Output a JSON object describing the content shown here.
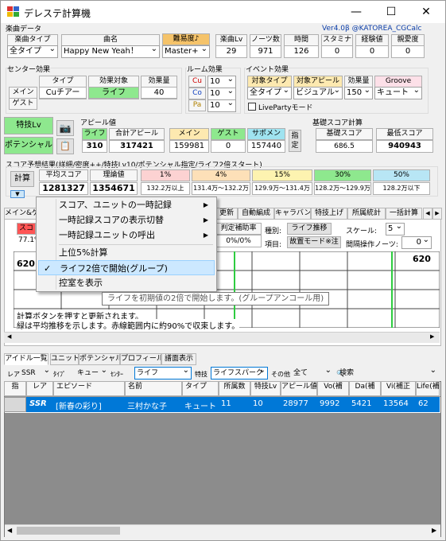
{
  "window": {
    "title": "デレステ計算機",
    "minimize": "—",
    "maximize": "☐",
    "close": "✕"
  },
  "song": {
    "section": "楽曲データ",
    "version": "Ver4.0β @KATOREA_CGCalc",
    "headers": {
      "type": "楽曲タイプ",
      "name": "曲名",
      "difficulty": "難易度♪",
      "level": "楽曲Lv",
      "notes": "ノーツ数",
      "time": "時間",
      "stamina": "スタミナ",
      "exp": "経験値",
      "affection": "親愛度"
    },
    "values": {
      "type": "全タイプ",
      "name": "Happy New Yeah！",
      "difficulty": "Master+",
      "level": "29",
      "notes": "971",
      "time": "126",
      "stamina": "0",
      "exp": "0",
      "affection": "0"
    }
  },
  "center": {
    "section": "センター効果",
    "headers": [
      "タイプ",
      "効果対象",
      "効果量"
    ],
    "main_label": "メイン",
    "guest_label": "ゲスト",
    "main_type": "Cuチアー",
    "main_target": "ライフ",
    "main_amount": "40"
  },
  "room": {
    "section": "ルーム効果",
    "rows": [
      {
        "label": "Cu",
        "value": "10"
      },
      {
        "label": "Co",
        "value": "10"
      },
      {
        "label": "Pa",
        "value": "10"
      }
    ]
  },
  "event": {
    "section": "イベント効果",
    "headers": [
      "対象タイプ",
      "対象アピール",
      "効果量",
      "Groove"
    ],
    "type": "全タイプ",
    "appeal": "ビジュアル",
    "amount": "150",
    "groove": "キュート",
    "liveparty": "LivePartyモード"
  },
  "skill_btn": "特技Lv",
  "potential_btn": "ポテンシャル",
  "appeal": {
    "section": "アピール値",
    "headers": [
      "ライフ",
      "合計アピール",
      "メイン",
      "ゲスト",
      "サポメン"
    ],
    "values": [
      "310",
      "317421",
      "159981",
      "0",
      "157440"
    ],
    "specify": "指定"
  },
  "base": {
    "section": "基礎スコア計算",
    "headers": [
      "基礎スコア",
      "最低スコア"
    ],
    "values": [
      "686.5",
      "940943"
    ]
  },
  "predict": {
    "section": "スコア予想結果(詳細/密度++/特技Lv10/ポテンシャル指定/ライフ2倍スタート)",
    "calc": "計算",
    "headers": [
      "平均スコア",
      "理論値"
    ],
    "values": [
      "1281327",
      "1354671"
    ],
    "pct_headers": [
      "1%",
      "4%",
      "15%",
      "30%",
      "50%"
    ],
    "pct_values": [
      "132.2万以上",
      "131.4万～132.2万",
      "129.9万～131.4万",
      "128.2万～129.9万",
      "128.2万以下"
    ]
  },
  "tabs2": [
    "メイン&ゲ",
    "更新",
    "自動編成",
    "キャラバン",
    "特技上げ",
    "所属統計",
    "一括計算"
  ],
  "mid": {
    "label1": "スコ",
    "label2": "77.1%",
    "judge": "判定補助率",
    "judge_val": "0%/0%",
    "kind_label": "種別:",
    "kind_btn": "ライフ推移",
    "item_label": "項目:",
    "item_btn": "故置モード※注",
    "scale_label": "スケール:",
    "scale_val": "5",
    "interval_label": "間隔操作ノーツ:",
    "interval_val": "0",
    "v620a": "620",
    "v620b": "620"
  },
  "menu": {
    "items": [
      "スコア、ユニットの一時記録",
      "一時記録スコアの表示切替",
      "一時記録ユニットの呼出",
      "上位5%計算",
      "ライフ2倍で開始(グループ)",
      "控室を表示"
    ],
    "tooltip": "ライフを初期値の2倍で開始します。(グループアンコール用)"
  },
  "note": {
    "line1": "計算ボタンを押すと更新されます。",
    "line2": "緑は平均推移を示します。赤線範囲内に約90%で収束します。"
  },
  "bottom_tabs": [
    "アイドル一覧",
    "ユニット",
    "ポテンシャル",
    "プロフィール",
    "譜面表示"
  ],
  "filters": {
    "rarity_label": "レア",
    "rarity": "SSR",
    "type_label": "ﾀｲﾌﾟ",
    "type": "キュー",
    "center_label": "ｾﾝﾀｰ",
    "center": "ライフ",
    "skill_label": "特技",
    "skill": "ライフスパーク",
    "other_label": "その他",
    "other": "全て",
    "search": "検索"
  },
  "table": {
    "headers": [
      "指",
      "レア",
      "エピソード",
      "名前",
      "タイプ",
      "所属数",
      "特技Lv",
      "アピール値",
      "Vo(補",
      "Da(補",
      "Vi(補正",
      "Life(補"
    ],
    "rows": [
      [
        "",
        "SSR",
        "[新春の彩り]",
        "三村かな子",
        "キュート",
        "11",
        "10",
        "28977",
        "9992",
        "5421",
        "13564",
        "62"
      ]
    ]
  },
  "colors": {
    "accent": "#0078d7"
  }
}
